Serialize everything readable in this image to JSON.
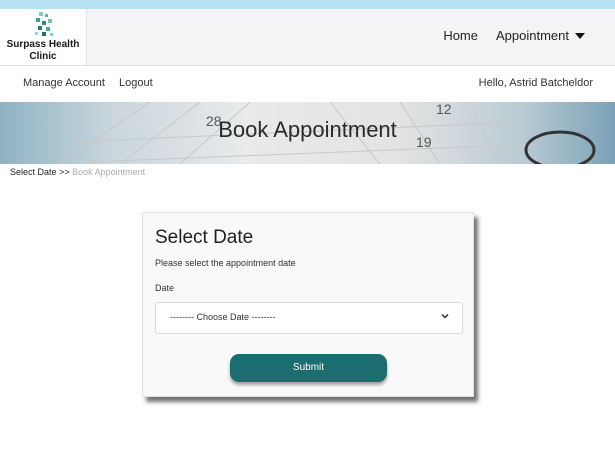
{
  "brand": {
    "name_line1": "Surpass Health",
    "name_line2": "Clinic"
  },
  "nav": {
    "home": "Home",
    "appointment": "Appointment"
  },
  "account": {
    "manage": "Manage Account",
    "logout": "Logout",
    "greeting": "Hello, Astrid Batcheldor"
  },
  "banner": {
    "title": "Book Appointment"
  },
  "breadcrumb": {
    "current": "Select Date >>",
    "next": "Book Appointment"
  },
  "form": {
    "title": "Select Date",
    "subtitle": "Please select the appointment date",
    "date_label": "Date",
    "date_selected": "-------- Choose Date --------",
    "submit_label": "Submit"
  },
  "colors": {
    "accent": "#1b6d70",
    "top_bar": "#b9e3f2",
    "header_bg": "#f4f3f5"
  }
}
